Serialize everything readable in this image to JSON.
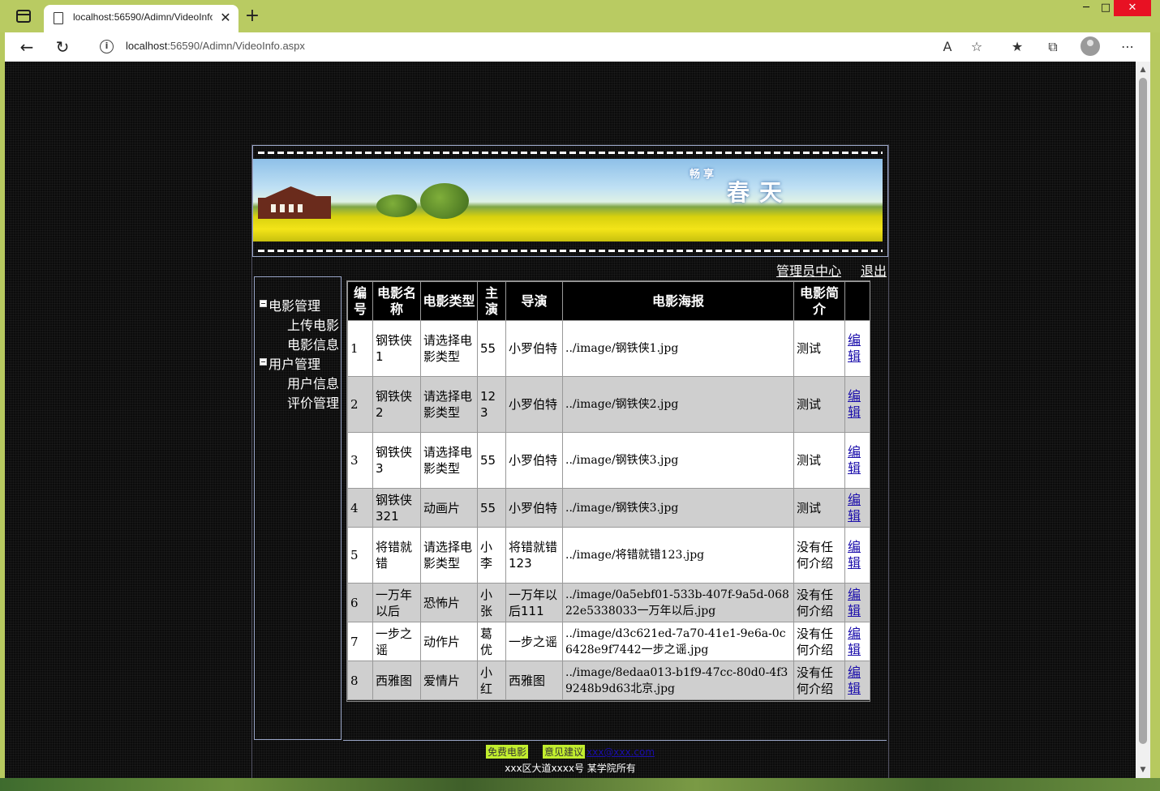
{
  "browser": {
    "tab_title": "localhost:56590/Adimn/VideoInfo",
    "tab_close": "✕",
    "new_tab": "+",
    "url_host": "localhost",
    "url_rest": ":56590/Adimn/VideoInfo.aspx"
  },
  "banner": {
    "small_text": "畅享",
    "big_text": "春天"
  },
  "top_links": {
    "admin_center": "管理员中心",
    "logout": "退出"
  },
  "sidebar": {
    "groups": [
      {
        "label": "电影管理",
        "items": [
          "上传电影",
          "电影信息"
        ]
      },
      {
        "label": "用户管理",
        "items": [
          "用户信息",
          "评价管理"
        ]
      }
    ]
  },
  "table": {
    "headers": [
      "编号",
      "电影名称",
      "电影类型",
      "主演",
      "导演",
      "电影海报",
      "电影简介",
      ""
    ],
    "edit_label": "编辑",
    "rows": [
      {
        "id": "1",
        "name": "钢铁侠1",
        "type": "请选择电影类型",
        "actor": "55",
        "director": "小罗伯特",
        "poster": "../image/钢铁侠1.jpg",
        "intro": "测试"
      },
      {
        "id": "2",
        "name": "钢铁侠2",
        "type": "请选择电影类型",
        "actor": "123",
        "director": "小罗伯特",
        "poster": "../image/钢铁侠2.jpg",
        "intro": "测试"
      },
      {
        "id": "3",
        "name": "钢铁侠3",
        "type": "请选择电影类型",
        "actor": "55",
        "director": "小罗伯特",
        "poster": "../image/钢铁侠3.jpg",
        "intro": "测试"
      },
      {
        "id": "4",
        "name": "钢铁侠321",
        "type": "动画片",
        "actor": "55",
        "director": "小罗伯特",
        "poster": "../image/钢铁侠3.jpg",
        "intro": "测试"
      },
      {
        "id": "5",
        "name": "将错就错",
        "type": "请选择电影类型",
        "actor": "小李",
        "director": "将错就错123",
        "poster": "../image/将错就错123.jpg",
        "intro": "没有任何介绍"
      },
      {
        "id": "6",
        "name": "一万年以后",
        "type": "恐怖片",
        "actor": "小张",
        "director": "一万年以后111",
        "poster": "../image/0a5ebf01-533b-407f-9a5d-06822e5338033一万年以后.jpg",
        "intro": "没有任何介绍"
      },
      {
        "id": "7",
        "name": "一步之谣",
        "type": "动作片",
        "actor": "葛优",
        "director": "一步之谣",
        "poster": "../image/d3c621ed-7a70-41e1-9e6a-0c6428e9f7442一步之谣.jpg",
        "intro": "没有任何介绍"
      },
      {
        "id": "8",
        "name": "西雅图",
        "type": "爱情片",
        "actor": "小红",
        "director": "西雅图",
        "poster": "../image/8edaa013-b1f9-47cc-80d0-4f39248b9d63北京.jpg",
        "intro": "没有任何介绍"
      }
    ]
  },
  "footer": {
    "free_movies": "免费电影",
    "suggestions": "意见建议",
    "email": "xxx@xxx.com",
    "address": "xxx区大道xxxx号  某学院所有"
  }
}
